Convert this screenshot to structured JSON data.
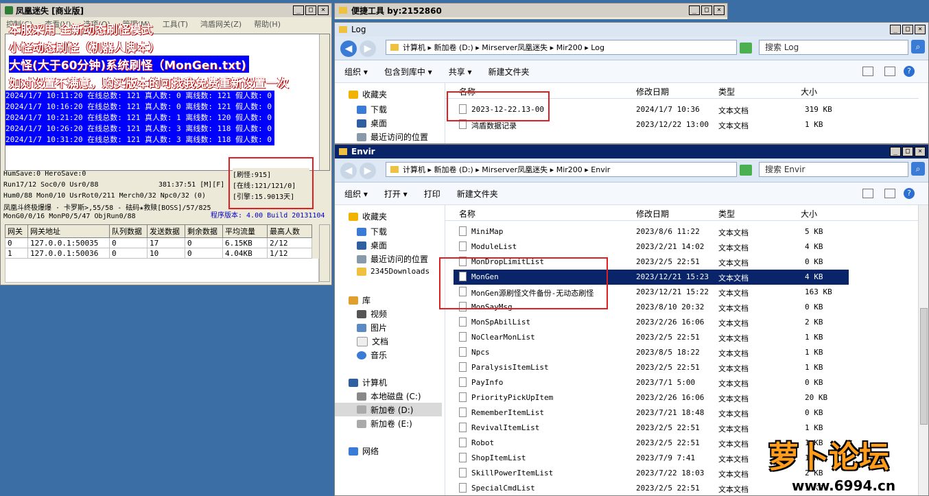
{
  "left_window": {
    "title": "凤凰迷失 [商业版]",
    "menu": [
      "控制(C)",
      "查看(V)",
      "选项(O)",
      "管理(M)",
      "工具(T)",
      "鸿盾网关(Z)",
      "帮助(H)"
    ],
    "overlay_lines": [
      "本服采用 全新动态刷怪模式",
      "小怪动态刷怪（机器人脚本）",
      "大怪(大于60分钟)系统刷怪（MonGen.txt)",
      "如对设置不满意，购买版本的可找我免费重新设置一次"
    ],
    "log_lines": [
      "2024/1/7 10:11:20 在线总数: 121 真人数: 0 离线数: 121 假人数: 0",
      "2024/1/7 10:16:20 在线总数: 121 真人数: 0 离线数: 121 假人数: 0",
      "2024/1/7 10:21:20 在线总数: 121 真人数: 1 离线数: 120 假人数: 0",
      "2024/1/7 10:26:20 在线总数: 121 真人数: 3 离线数: 118 假人数: 0",
      "2024/1/7 10:31:20 在线总数: 121 真人数: 3 离线数: 118 假人数: 0"
    ],
    "status": {
      "line1": "HumSave:0 HeroSave:0",
      "line2": "Run17/12 Soc0/0 Usr0/88",
      "line2_time": "381:37:51 [M][F]",
      "line3": "Hum0/88 Mon0/10 UsrRot0/211 Merch0/32 Npc0/32 (0)",
      "line4": "凤凰斗终极爆爆 · 卡罗斯>,55/58 - 砝码★救赎[BOSS]/57/825",
      "line5": "MonG0/0/16 MonP0/5/47 ObjRun0/88",
      "version": "程序版本: 4.00 Build 20131104"
    },
    "stats_box": {
      "refresh": "[刷怪:915]",
      "online": "[在线:121/121/0]",
      "engine": "[引擎:15.9013天]"
    },
    "gateway_table": {
      "headers": [
        "网关",
        "网关地址",
        "队列数据",
        "发送数据",
        "剩余数据",
        "平均流量",
        "最高人数"
      ],
      "rows": [
        [
          "0",
          "127.0.0.1:50035",
          "0",
          "17",
          "0",
          "6.15KB",
          "2/12"
        ],
        [
          "1",
          "127.0.0.1:50036",
          "0",
          "10",
          "0",
          "4.04KB",
          "1/12"
        ]
      ]
    }
  },
  "tool_window": {
    "title": "便捷工具   by:2152860"
  },
  "log_window": {
    "title": "Log",
    "breadcrumb": [
      "计算机",
      "新加卷 (D:)",
      "Mirserver凤凰迷失",
      "Mir200",
      "Log"
    ],
    "search_placeholder": "搜索 Log",
    "toolbar": [
      "组织 ▾",
      "包含到库中 ▾",
      "共享 ▾",
      "新建文件夹"
    ],
    "nav": [
      "收藏夹",
      "下载",
      "桌面",
      "最近访问的位置"
    ],
    "columns": [
      "名称",
      "修改日期",
      "类型",
      "大小"
    ],
    "files": [
      {
        "name": "2023-12-22.13-00",
        "date": "2024/1/7 10:36",
        "type": "文本文档",
        "size": "319 KB"
      },
      {
        "name": "鸿盾数据记录",
        "date": "2023/12/22 13:00",
        "type": "文本文档",
        "size": "1 KB"
      }
    ]
  },
  "envir_window": {
    "title": "Envir",
    "breadcrumb": [
      "计算机",
      "新加卷 (D:)",
      "Mirserver凤凰迷失",
      "Mir200",
      "Envir"
    ],
    "search_placeholder": "搜索 Envir",
    "toolbar": [
      "组织 ▾",
      "打开 ▾",
      "打印",
      "新建文件夹"
    ],
    "nav": {
      "favorites": [
        "收藏夹",
        "下载",
        "桌面",
        "最近访问的位置",
        "2345Downloads"
      ],
      "libraries": [
        "库",
        "视频",
        "图片",
        "文档",
        "音乐"
      ],
      "computer": [
        "计算机",
        "本地磁盘 (C:)",
        "新加卷 (D:)",
        "新加卷 (E:)"
      ],
      "network": "网络"
    },
    "columns": [
      "名称",
      "修改日期",
      "类型",
      "大小"
    ],
    "files": [
      {
        "name": "MiniMap",
        "date": "2023/8/6 11:22",
        "type": "文本文档",
        "size": "5 KB"
      },
      {
        "name": "ModuleList",
        "date": "2023/2/21 14:02",
        "type": "文本文档",
        "size": "4 KB"
      },
      {
        "name": "MonDropLimitList",
        "date": "2023/2/5 22:51",
        "type": "文本文档",
        "size": "0 KB"
      },
      {
        "name": "MonGen",
        "date": "2023/12/21 15:23",
        "type": "文本文档",
        "size": "4 KB"
      },
      {
        "name": "MonGen源刷怪文件备份-无动态刷怪",
        "date": "2023/12/21 15:22",
        "type": "文本文档",
        "size": "163 KB"
      },
      {
        "name": "MonSayMsg",
        "date": "2023/8/10 20:32",
        "type": "文本文档",
        "size": "0 KB"
      },
      {
        "name": "MonSpAbilList",
        "date": "2023/2/26 16:06",
        "type": "文本文档",
        "size": "2 KB"
      },
      {
        "name": "NoClearMonList",
        "date": "2023/2/5 22:51",
        "type": "文本文档",
        "size": "1 KB"
      },
      {
        "name": "Npcs",
        "date": "2023/8/5 18:22",
        "type": "文本文档",
        "size": "1 KB"
      },
      {
        "name": "ParalysisItemList",
        "date": "2023/2/5 22:51",
        "type": "文本文档",
        "size": "1 KB"
      },
      {
        "name": "PayInfo",
        "date": "2023/7/1 5:00",
        "type": "文本文档",
        "size": "0 KB"
      },
      {
        "name": "PriorityPickUpItem",
        "date": "2023/2/26 16:06",
        "type": "文本文档",
        "size": "20 KB"
      },
      {
        "name": "RememberItemList",
        "date": "2023/7/21 18:48",
        "type": "文本文档",
        "size": "0 KB"
      },
      {
        "name": "RevivalItemList",
        "date": "2023/2/5 22:51",
        "type": "文本文档",
        "size": "1 KB"
      },
      {
        "name": "Robot",
        "date": "2023/2/5 22:51",
        "type": "文本文档",
        "size": "1 KB"
      },
      {
        "name": "ShopItemList",
        "date": "2023/7/9 7:41",
        "type": "文本文档",
        "size": "1 KB"
      },
      {
        "name": "SkillPowerItemList",
        "date": "2023/7/22 18:03",
        "type": "文本文档",
        "size": "2 KB"
      },
      {
        "name": "SpecialCmdList",
        "date": "2023/2/5 22:51",
        "type": "文本文档",
        "size": "1 KB"
      }
    ]
  },
  "watermark": {
    "logo": "萝卜论坛",
    "url": "www.6994.cn"
  }
}
